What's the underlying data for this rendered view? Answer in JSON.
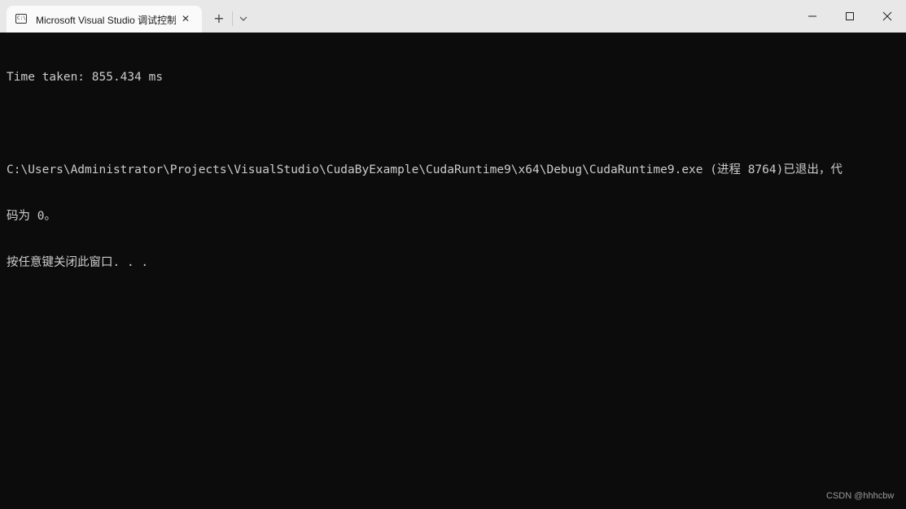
{
  "window": {
    "tab_title": "Microsoft Visual Studio 调试控制台",
    "tab_icon": "console-app-icon",
    "tab_icon_glyph": "C:\\",
    "tab_close": "✕",
    "new_tab": "+",
    "controls": [
      "minimize-icon",
      "maximize-icon",
      "close-icon"
    ]
  },
  "console": {
    "lines": [
      "Time taken: 855.434 ms",
      "",
      "C:\\Users\\Administrator\\Projects\\VisualStudio\\CudaByExample\\CudaRuntime9\\x64\\Debug\\CudaRuntime9.exe (进程 8764)已退出，代",
      "码为 0。",
      "按任意键关闭此窗口. . ."
    ],
    "text_color": "#cccccc",
    "background_color": "#0c0c0c"
  },
  "watermark": "CSDN @hhhcbw"
}
